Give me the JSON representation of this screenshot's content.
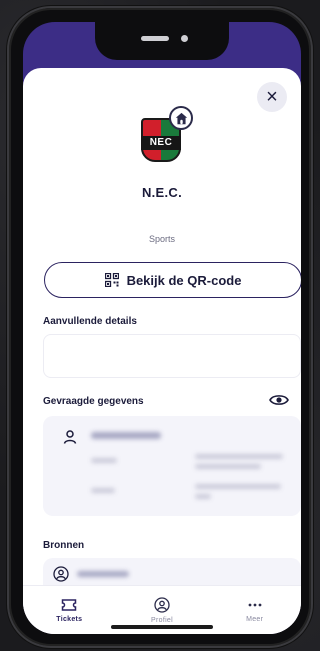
{
  "club": {
    "name": "N.E.C.",
    "logo_text": "NEC",
    "category": "Sports"
  },
  "actions": {
    "qr_button_label": "Bekijk de QR-code",
    "close_symbol": "×"
  },
  "sections": {
    "additional_details_title": "Aanvullende details",
    "requested_data_title": "Gevraagde gegevens",
    "sources_title": "Bronnen"
  },
  "tabbar": {
    "items": [
      {
        "label": "Tickets",
        "icon": "ticket-icon",
        "active": true
      },
      {
        "label": "Profiel",
        "icon": "profile-icon",
        "active": false
      },
      {
        "label": "Meer",
        "icon": "more-icon",
        "active": false
      }
    ]
  },
  "colors": {
    "brand_purple": "#3c2d86",
    "text_dark": "#1b1b3a",
    "card_bg": "#f4f4fa"
  }
}
